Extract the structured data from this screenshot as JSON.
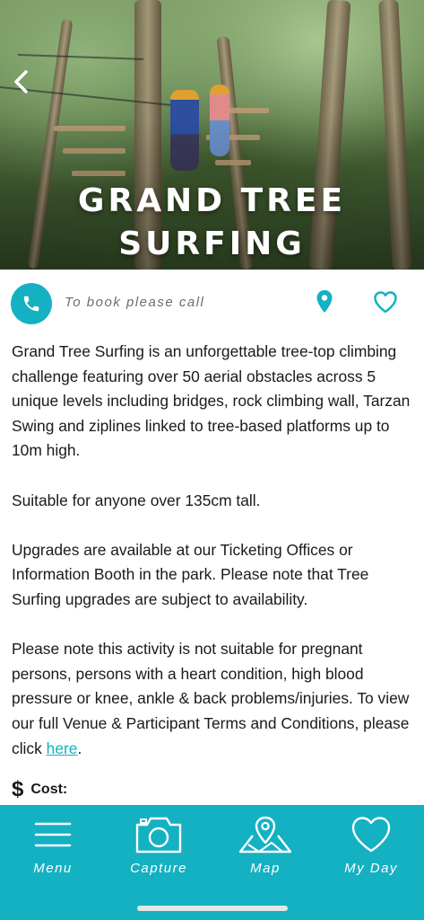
{
  "hero": {
    "title": "GRAND TREE\nSURFING"
  },
  "booking": {
    "text": "To book please call"
  },
  "description": {
    "paragraphs": [
      "Grand Tree Surfing is an unforgettable tree-top climbing challenge featuring over 50 aerial obstacles across 5 unique levels including bridges, rock climbing wall, Tarzan Swing and ziplines linked to tree-based platforms up to 10m high.",
      "Suitable for anyone over 135cm tall.",
      "Upgrades are available at our Ticketing Offices or Information Booth in the park. Please note that Tree Surfing upgrades are subject to availability."
    ],
    "terms_text": "Please note this activity is not suitable for pregnant persons, persons with a heart condition, high blood pressure or knee, ankle & back problems/injuries. To view our full Venue & Participant Terms and Conditions, please click ",
    "terms_link": "here",
    "terms_end": "."
  },
  "cost": {
    "icon": "$",
    "label": "Cost:"
  },
  "nav": {
    "items": [
      {
        "label": "Menu",
        "icon": "menu-icon"
      },
      {
        "label": "Capture",
        "icon": "camera-icon"
      },
      {
        "label": "Map",
        "icon": "map-icon"
      },
      {
        "label": "My Day",
        "icon": "heart-icon"
      }
    ]
  },
  "colors": {
    "accent": "#14b1c2",
    "text": "#1a1a1a",
    "muted": "#6d6d6d"
  }
}
